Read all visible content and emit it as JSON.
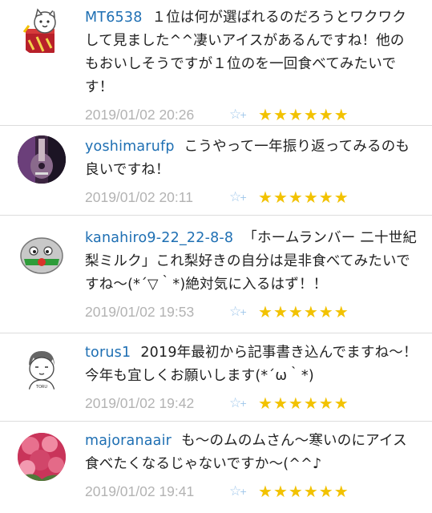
{
  "comments": [
    {
      "username": "MT6538",
      "text": "１位は何が選ばれるのだろうとワクワクして見ました^^凄いアイスがあるんですね！他のもおいしそうですが１位のを一回食べてみたいです！",
      "date": "2019/01/02 20:26",
      "avatar": "cat-box-avatar",
      "stars": 6
    },
    {
      "username": "yoshimarufp",
      "text": "こうやって一年振り返ってみるのも良いですね！",
      "date": "2019/01/02 20:11",
      "avatar": "guitar-photo-avatar",
      "stars": 6
    },
    {
      "username": "kanahiro9-22_22-8-8",
      "text": "「ホームランバー 二十世紀梨ミルク」これ梨好きの自分は是非食べてみたいですね〜(*´▽｀*)絶対気に入るはず！！",
      "date": "2019/01/02 19:53",
      "avatar": "blob-character-avatar",
      "stars": 6
    },
    {
      "username": "torus1",
      "text": "2019年最初から記事書き込んでますね〜！今年も宜しくお願いします(*´ω｀*)",
      "date": "2019/01/02 19:42",
      "avatar": "sketch-person-avatar",
      "stars": 6
    },
    {
      "username": "majoranaair",
      "text": "も〜のムのムさん〜寒いのにアイス食べたくなるじゃないですか〜(^^♪",
      "date": "2019/01/02 19:41",
      "avatar": "roses-photo-avatar",
      "stars": 6
    }
  ],
  "icons": {
    "add_star": "star-outline-plus-icon",
    "star": "star-filled-icon"
  },
  "colors": {
    "username": "#1e6fb3",
    "date": "#b3b3b3",
    "star": "#f2c200",
    "add_star": "#9ec6ea",
    "divider": "#dcdcdc"
  }
}
